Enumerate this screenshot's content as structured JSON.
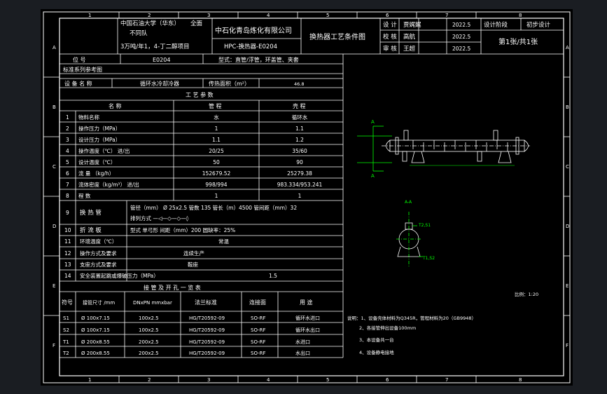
{
  "colors": {
    "bg": "#1a1d22",
    "paper": "#000000",
    "line": "#ffffff",
    "accent": "#00ff00",
    "dim": "#00ff00"
  },
  "title_block": {
    "university": "中国石油大学（华东）",
    "major_class": "不同队",
    "project": "3万吨/年1，4-丁二醇项目",
    "stage": "全面",
    "company": "中石化青岛炼化有限公司",
    "drawing_no": "HPC-换热器-E0204",
    "drawing_title": "换热器工艺条件图",
    "design_label": "设 计",
    "design_name": "贾娓娓",
    "check_label": "校 核",
    "check_name": "高航",
    "review_label": "审 核",
    "review_name": "王超",
    "date1": "2022.5",
    "date2": "2022.5",
    "date3": "2022.5",
    "phase_label": "设计阶段",
    "phase_value": "初步设计",
    "sheet": "第1张/共1张"
  },
  "frame": {
    "col_numbers": [
      "1",
      "2",
      "3",
      "4",
      "5",
      "6",
      "7",
      "8"
    ],
    "row_letters": [
      "A",
      "B",
      "C",
      "D",
      "E",
      "F"
    ]
  },
  "header_rows": {
    "position_label": "位 号",
    "position_value": "E0204",
    "type_label": "型式：直管/浮管，环盖管、夹套",
    "ref_label": "标准系列参考图",
    "equip_name_label": "设 备 名 称",
    "equip_name_value": "循环水冷却冷器",
    "area_label": "传热面积（m²）",
    "area_value": "46.8"
  },
  "process_table": {
    "title": "工 艺 参 数",
    "headers": [
      "名 称",
      "管 程",
      "壳 程"
    ],
    "rows": [
      {
        "no": "1",
        "name": "物料名称",
        "tube": "水",
        "shell": "循环水"
      },
      {
        "no": "2",
        "name": "操作压力（MPa）",
        "tube": "1",
        "shell": "1.1"
      },
      {
        "no": "3",
        "name": "设计压力（MPa）",
        "tube": "1.1",
        "shell": "1.2"
      },
      {
        "no": "4",
        "name": "操作温度（℃） 进/出",
        "tube": "20/25",
        "shell": "35/60"
      },
      {
        "no": "5",
        "name": "设计温度（℃）",
        "tube": "50",
        "shell": "90"
      },
      {
        "no": "6",
        "name": "流 量 （kg/h）",
        "tube": "152679.52",
        "shell": "25279.38"
      },
      {
        "no": "7",
        "name": "流体密度（kg/m³） 进/出",
        "tube": "998/994",
        "shell": "983.334/953.241"
      },
      {
        "no": "8",
        "name": "程 数",
        "tube": "1",
        "shell": "1"
      }
    ],
    "row9_no": "9",
    "row9_label": "换 热 管",
    "row9_line1": "管径（mm） Ø 25x2.5  管数 135  管长（m）4500  管间距（mm）32",
    "row9_line2": "排列方式 —◁—◇—◇—◊",
    "row10_no": "10",
    "row10_label": "折 流 板",
    "row10_value": "型式 单弓形      间距（mm）200      圆缺率：25%",
    "row11_no": "11",
    "row11_label": "环境温度（℃）",
    "row11_value": "常温",
    "row12_no": "12",
    "row12_label": "操作方式及要求",
    "row12_value": "连续生产",
    "row13_no": "13",
    "row13_label": "支座方式及要求",
    "row13_value": "鞍座",
    "row14_no": "14",
    "row14_label": "安全装置起跳或爆破压力（MPa）",
    "row14_value": "1.5"
  },
  "nozzle_table": {
    "title": "接 管 及 开 孔 一 览 表",
    "headers": [
      "符号",
      "接管尺寸 /mm",
      "DNxPN mmxbar",
      "法兰标准",
      "连接面",
      "用 途"
    ],
    "rows": [
      {
        "sym": "S1",
        "size": "Ø 100x7.15",
        "dnpn": "100x2.5",
        "std": "HG/T20592-09",
        "face": "SO-RF",
        "use": "循环水进口"
      },
      {
        "sym": "S2",
        "size": "Ø 100x7.15",
        "dnpn": "100x2.5",
        "std": "HG/T20592-09",
        "face": "SO-RF",
        "use": "循环水出口"
      },
      {
        "sym": "T1",
        "size": "Ø 200x8.55",
        "dnpn": "200x2.5",
        "std": "HG/T20592-09",
        "face": "SO-RF",
        "use": "水进口"
      },
      {
        "sym": "T2",
        "size": "Ø 200x8.55",
        "dnpn": "200x2.5",
        "std": "HG/T20592-09",
        "face": "SO-RF",
        "use": "水出口"
      }
    ]
  },
  "notes": [
    "说明：1、设备壳体材料为Q345R，管程材料为20（GB9948）",
    "2、各接管伸出设备100mm",
    "3、本设备共一台",
    "4、设备静电接地"
  ],
  "scale": "比例：1:20",
  "drawing": {
    "label_a": "A",
    "section_title": "A-A",
    "nozzle_t2": "T2,S1",
    "nozzle_t1": "T1,S2"
  }
}
